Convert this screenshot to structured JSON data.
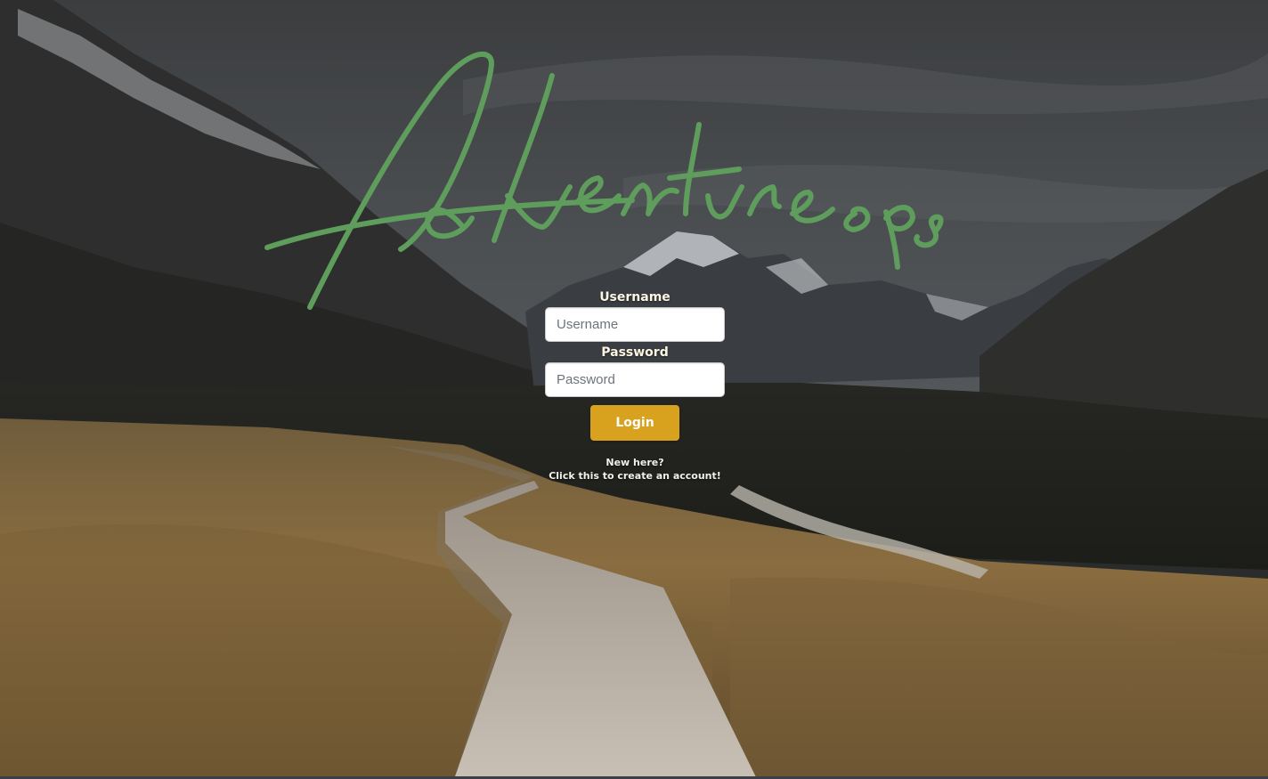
{
  "brand": {
    "name": "Adventureops",
    "color": "#5e9d5c"
  },
  "login_form": {
    "username": {
      "label": "Username",
      "placeholder": "Username",
      "value": ""
    },
    "password": {
      "label": "Password",
      "placeholder": "Password",
      "value": ""
    },
    "submit_label": "Login",
    "submit_color": "#d8a11e"
  },
  "signup_link": {
    "line1": "New here?",
    "line2": "Click this to create an account!"
  },
  "background": {
    "scene": "mountain valley boardwalk",
    "icon": "landscape-image"
  }
}
